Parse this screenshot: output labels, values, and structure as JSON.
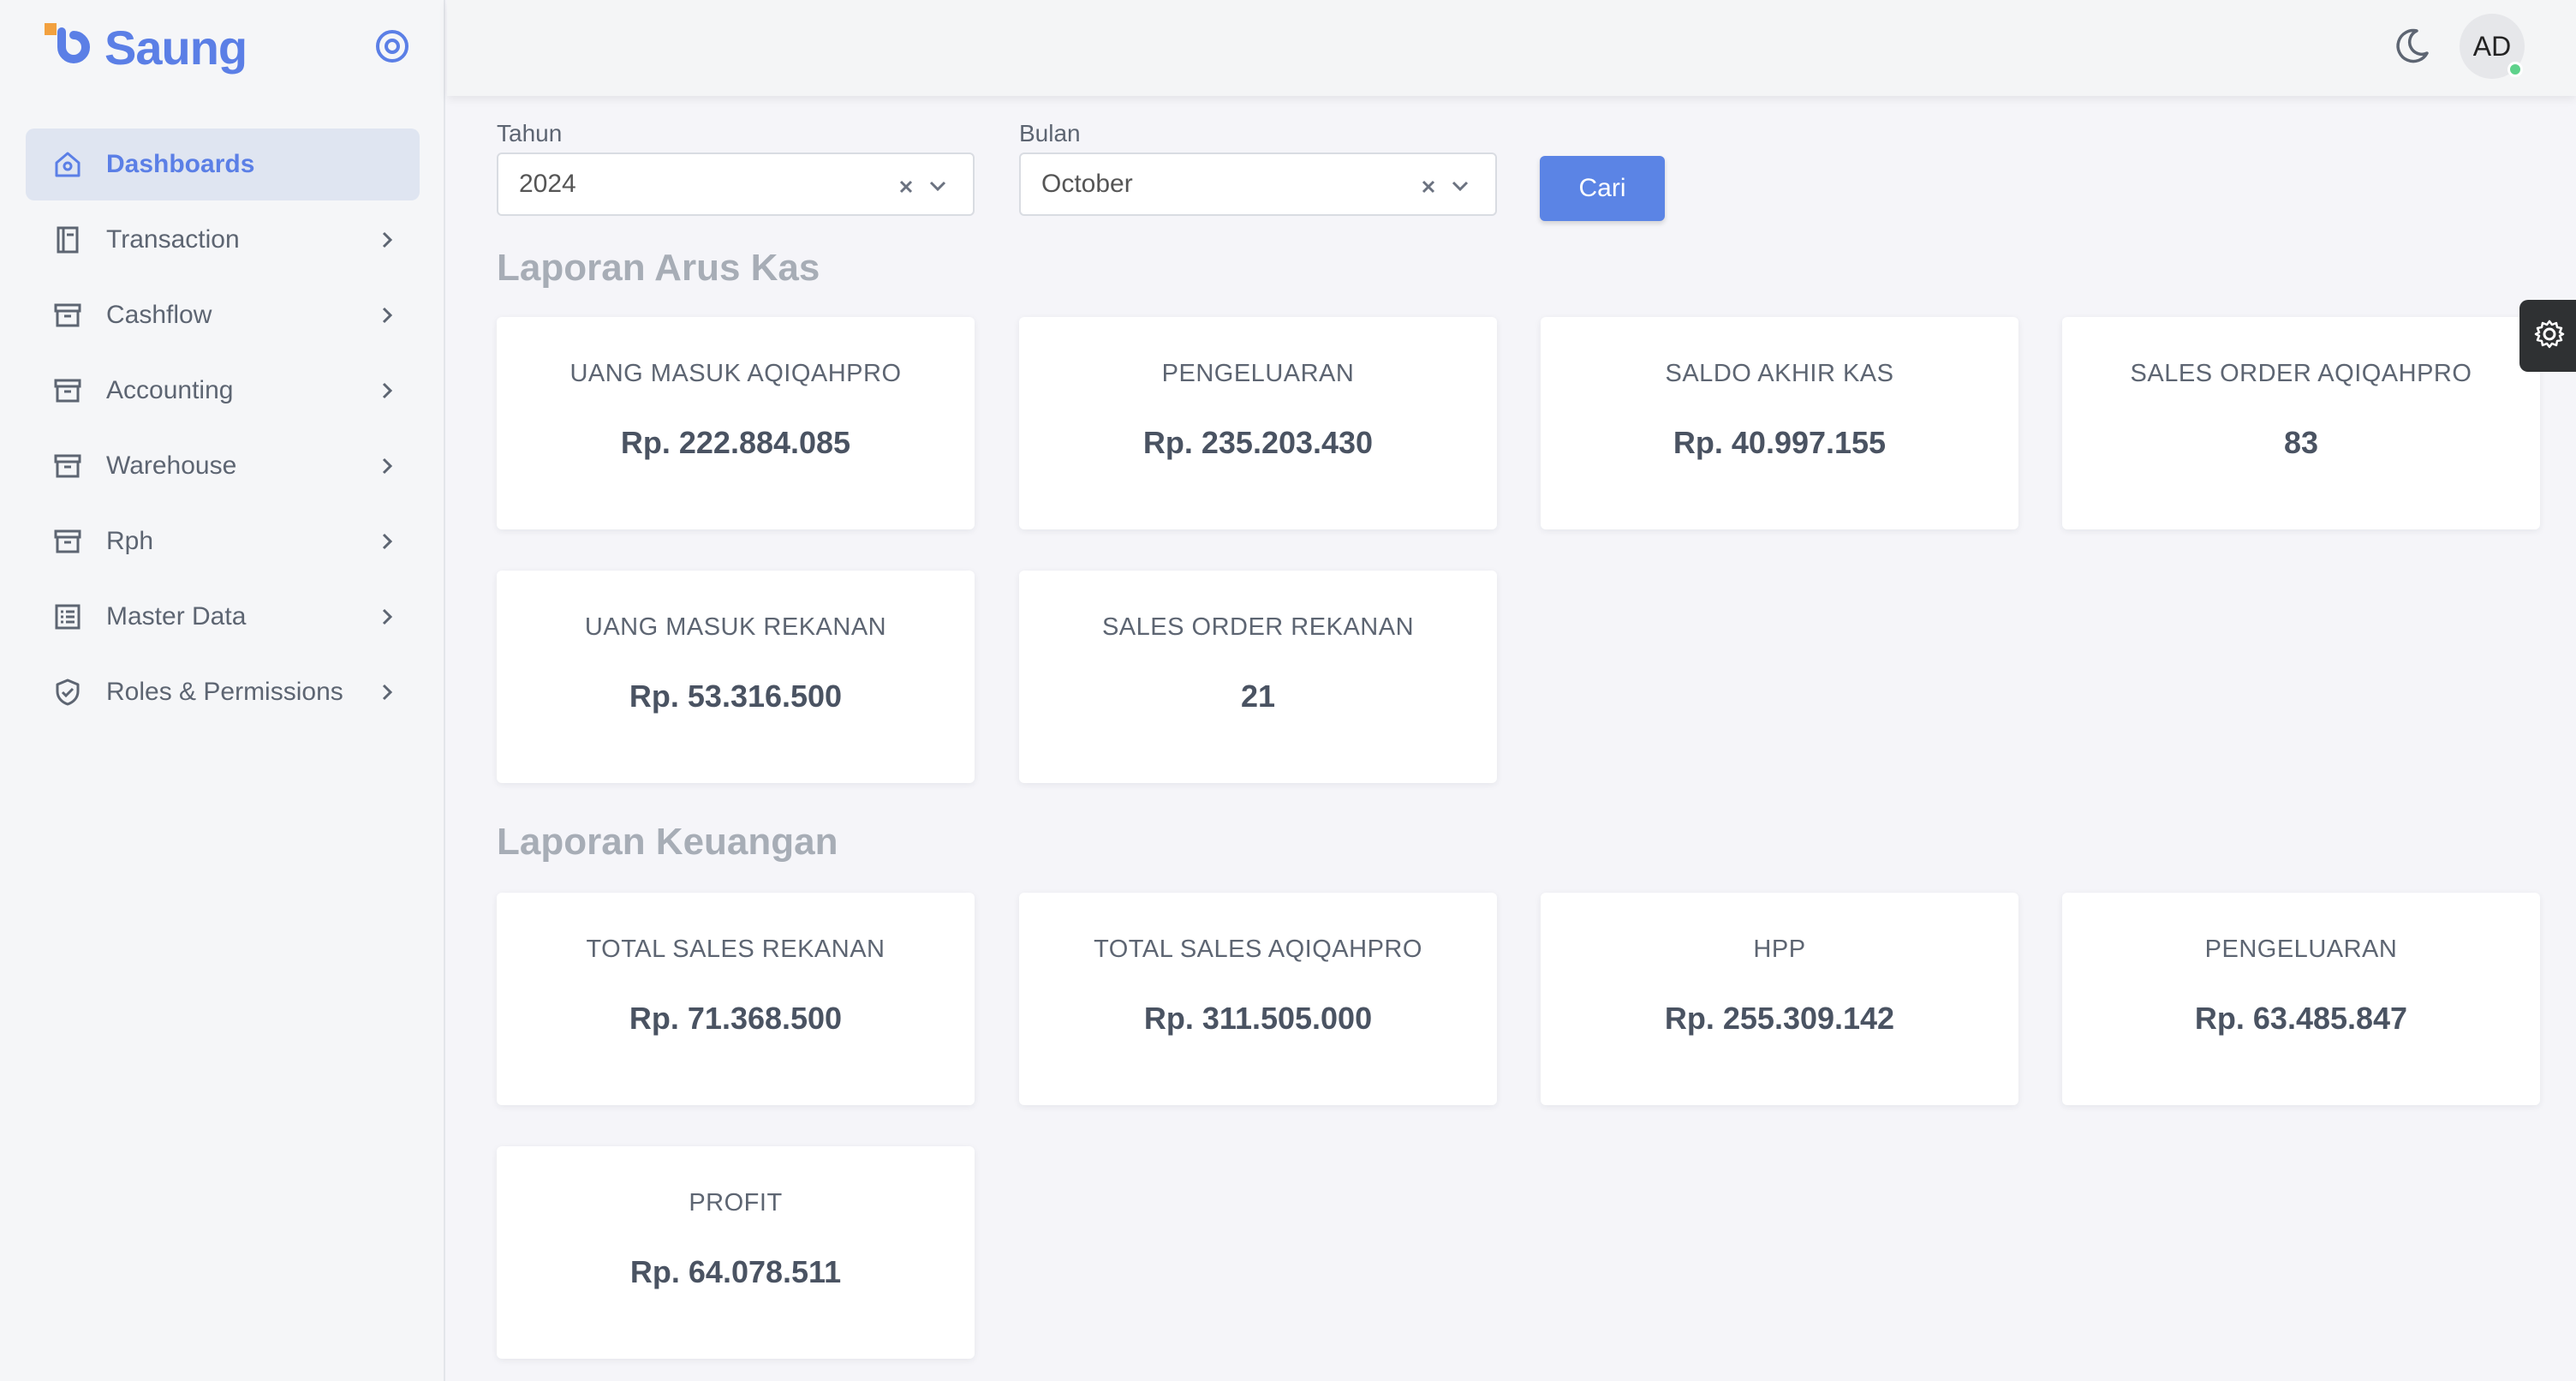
{
  "sidebar": {
    "brand_name": "Saung",
    "items": [
      {
        "label": "Dashboards",
        "icon": "home-icon",
        "active": true
      },
      {
        "label": "Transaction",
        "icon": "book-icon"
      },
      {
        "label": "Cashflow",
        "icon": "archive-icon"
      },
      {
        "label": "Accounting",
        "icon": "archive-icon"
      },
      {
        "label": "Warehouse",
        "icon": "archive-icon"
      },
      {
        "label": "Rph",
        "icon": "archive-icon"
      },
      {
        "label": "Master Data",
        "icon": "list-icon"
      },
      {
        "label": "Roles & Permissions",
        "icon": "shield-icon"
      }
    ]
  },
  "topbar": {
    "avatar_initials": "AD"
  },
  "filters": {
    "year_label": "Tahun",
    "year_value": "2024",
    "month_label": "Bulan",
    "month_value": "October",
    "search_label": "Cari"
  },
  "cashflow_report": {
    "title": "Laporan Arus Kas",
    "cards": [
      {
        "title": "UANG MASUK AQIQAHPRO",
        "value": "Rp. 222.884.085"
      },
      {
        "title": "PENGELUARAN",
        "value": "Rp. 235.203.430"
      },
      {
        "title": "SALDO AKHIR KAS",
        "value": "Rp. 40.997.155"
      },
      {
        "title": "SALES ORDER AQIQAHPRO",
        "value": "83"
      },
      {
        "title": "UANG MASUK REKANAN",
        "value": "Rp. 53.316.500"
      },
      {
        "title": "SALES ORDER REKANAN",
        "value": "21"
      }
    ]
  },
  "finance_report": {
    "title": "Laporan Keuangan",
    "cards": [
      {
        "title": "TOTAL SALES REKANAN",
        "value": "Rp. 71.368.500"
      },
      {
        "title": "TOTAL SALES AQIQAHPRO",
        "value": "Rp. 311.505.000"
      },
      {
        "title": "HPP",
        "value": "Rp. 255.309.142"
      },
      {
        "title": "PENGELUARAN",
        "value": "Rp. 63.485.847"
      },
      {
        "title": "PROFIT",
        "value": "Rp. 64.078.511"
      }
    ]
  },
  "colors": {
    "accent": "#5b7fe6",
    "button": "#5b84e5",
    "active_bg": "#dfe5f1",
    "logo_orange": "#f2a13f"
  }
}
